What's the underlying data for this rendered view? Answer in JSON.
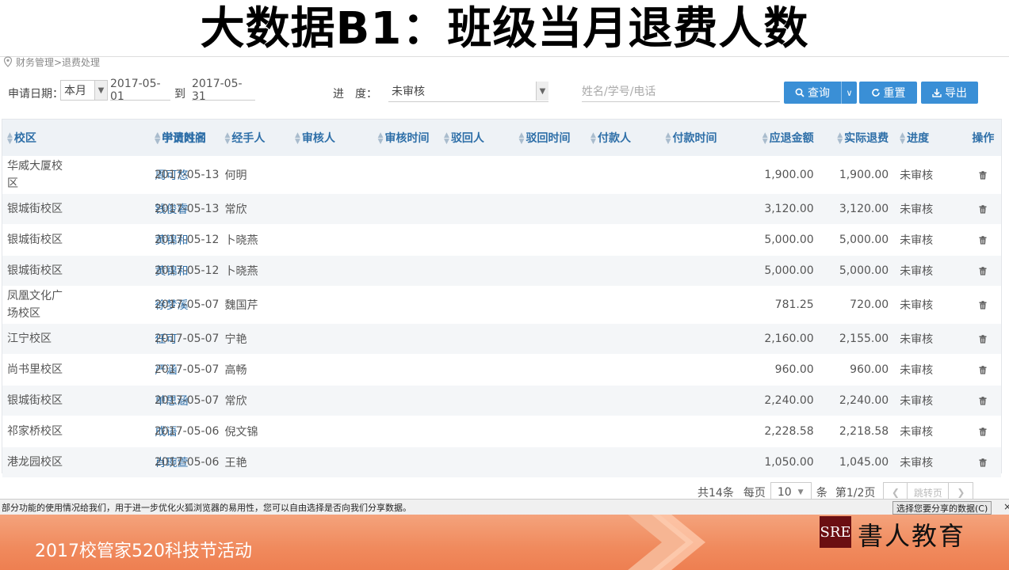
{
  "banner": {
    "title": "大数据B1：班级当月退费人数"
  },
  "breadcrumb": {
    "text": "财务管理>退费处理"
  },
  "filter": {
    "apply_date_label": "申请日期：",
    "period_value": "本月",
    "date_from": "2017-05-01",
    "to_label": "到",
    "date_to": "2017-05-31",
    "progress_label": "进　度：",
    "progress_value": "未审核",
    "search_placeholder": "姓名/学号/电话",
    "query_label": "查询",
    "reset_label": "重置",
    "export_label": "导出"
  },
  "table": {
    "columns": [
      "校区",
      "学员姓名",
      "申请时间",
      "经手人",
      "审核人",
      "审核时间",
      "驳回人",
      "驳回时间",
      "付款人",
      "付款时间",
      "应退金额",
      "实际退费",
      "进度",
      "操作"
    ],
    "rows": [
      {
        "campus": "华威大厦校区",
        "student": "周可悠",
        "date": "2017-05-13",
        "handler": "何明",
        "due": "1,900.00",
        "actual": "1,900.00",
        "status": "未审核"
      },
      {
        "campus": "银城街校区",
        "student": "钱俊睿",
        "date": "2017-05-13",
        "handler": "常欣",
        "due": "3,120.00",
        "actual": "3,120.00",
        "status": "未审核"
      },
      {
        "campus": "银城街校区",
        "student": "黄锦和",
        "date": "2017-05-12",
        "handler": "卜晓燕",
        "due": "5,000.00",
        "actual": "5,000.00",
        "status": "未审核"
      },
      {
        "campus": "银城街校区",
        "student": "黄锦和",
        "date": "2017-05-12",
        "handler": "卜晓燕",
        "due": "5,000.00",
        "actual": "5,000.00",
        "status": "未审核"
      },
      {
        "campus": "凤凰文化广场校区",
        "student": "徐梦溪",
        "date": "2017-05-07",
        "handler": "魏国芹",
        "due": "781.25",
        "actual": "720.00",
        "status": "未审核"
      },
      {
        "campus": "江宁校区",
        "student": "任可",
        "date": "2017-05-07",
        "handler": "宁艳",
        "due": "2,160.00",
        "actual": "2,155.00",
        "status": "未审核"
      },
      {
        "campus": "尚书里校区",
        "student": "严涵",
        "date": "2017-05-07",
        "handler": "高畅",
        "due": "960.00",
        "actual": "960.00",
        "status": "未审核"
      },
      {
        "campus": "银城街校区",
        "student": "单思涵",
        "date": "2017-05-07",
        "handler": "常欣",
        "due": "2,240.00",
        "actual": "2,240.00",
        "status": "未审核"
      },
      {
        "campus": "祁家桥校区",
        "student": "成语",
        "date": "2017-05-06",
        "handler": "倪文锦",
        "due": "2,228.58",
        "actual": "2,218.58",
        "status": "未审核"
      },
      {
        "campus": "港龙园校区",
        "student": "肖琬萱",
        "date": "2017-05-06",
        "handler": "王艳",
        "due": "1,050.00",
        "actual": "1,045.00",
        "status": "未审核"
      }
    ]
  },
  "pager": {
    "total": "共14条",
    "per_page_label": "每页",
    "per_page_value": "10",
    "unit": "条",
    "page_info": "第1/2页",
    "jump_label": "跳转页"
  },
  "notify": {
    "text": "部分功能的使用情况给我们，用于进一步优化火狐浏览器的易用性，您可以自由选择是否向我们分享数据。",
    "button": "选择您要分享的数据(C)",
    "close": "×"
  },
  "footer": {
    "event_text": "2017校管家520科技节活动",
    "logo_mark": "SRE",
    "logo_text": "書人教育"
  }
}
